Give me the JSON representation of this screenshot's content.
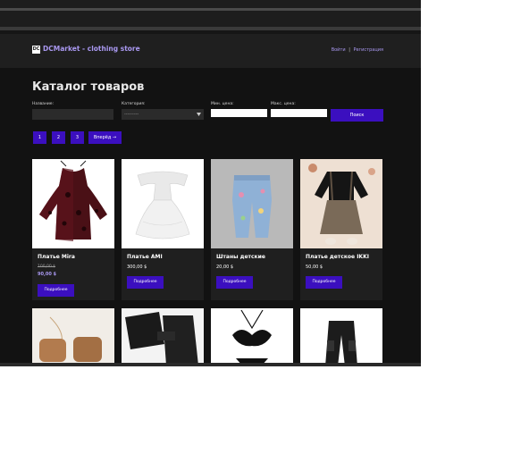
{
  "header": {
    "logo_text": "DC",
    "brand": "DCMarket - clothing store",
    "login": "Войти",
    "separator": "|",
    "register": "Регистрация"
  },
  "page": {
    "title": "Каталог товаров"
  },
  "filters": {
    "name_label": "Название:",
    "name_value": "",
    "category_label": "Категория:",
    "category_selected": "---------",
    "min_label": "Мин. цена:",
    "max_label": "Макс. цена:",
    "search_button": "Поиск"
  },
  "pagination": {
    "pages": [
      "1",
      "2",
      "3"
    ],
    "next": "Вперёд →"
  },
  "products": [
    {
      "name": "Платье Mira",
      "old_price": "100,00 $",
      "price": "90,00 $",
      "button": "Подробнее"
    },
    {
      "name": "Платье AMI",
      "price": "300,00 $",
      "button": "Подробнее"
    },
    {
      "name": "Штаны детские",
      "price": "20,00 $",
      "button": "Подробнее"
    },
    {
      "name": "Платье детское IKKI",
      "price": "50,00 $",
      "button": "Подробнее"
    }
  ],
  "colors": {
    "accent": "#3b0fbf",
    "brand": "#a998f0",
    "background": "#121212",
    "card": "#1f1f1f"
  }
}
